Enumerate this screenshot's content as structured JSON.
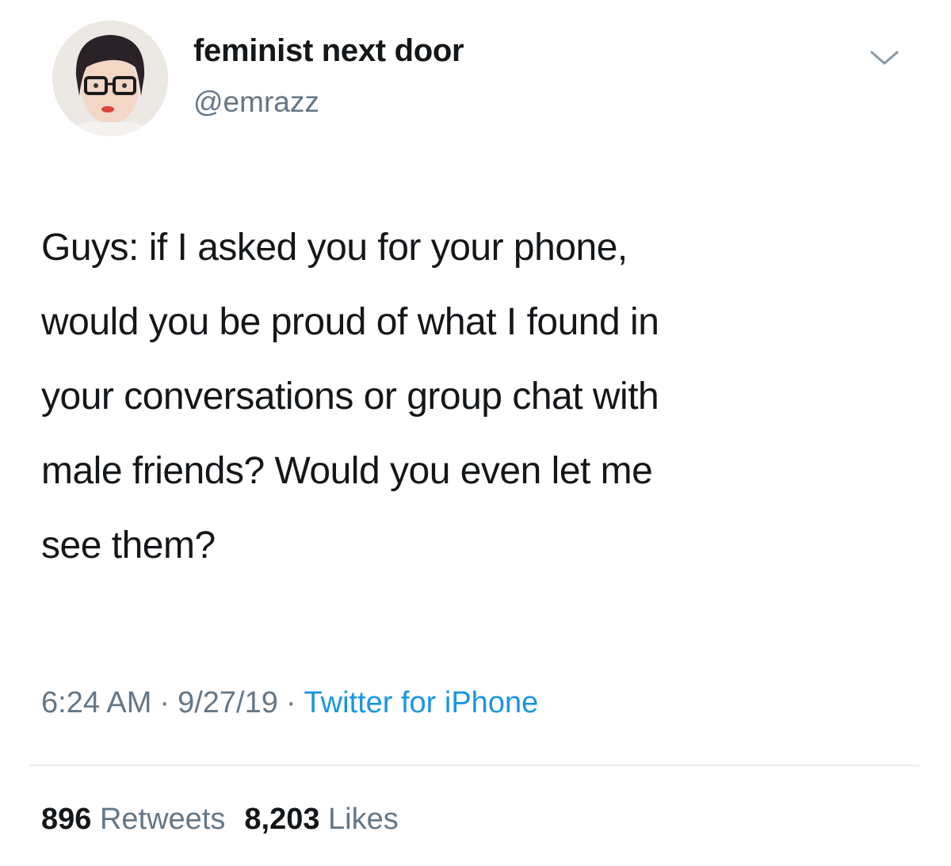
{
  "user": {
    "display_name": "feminist next door",
    "handle": "@emrazz"
  },
  "tweet": {
    "lines": [
      "Guys: if I asked you for your phone,",
      "would you be proud of what I found in",
      "your conversations or group chat with",
      "male friends? Would you even let me",
      "see them?"
    ]
  },
  "meta": {
    "time": "6:24 AM",
    "separator": "·",
    "date": "9/27/19",
    "source": "Twitter for iPhone"
  },
  "stats": {
    "retweets_count": "896",
    "retweets_label": "Retweets",
    "likes_count": "8,203",
    "likes_label": "Likes"
  },
  "colors": {
    "text": "#14171a",
    "secondary": "#657786",
    "link": "#1b95e0",
    "divider": "#e6ecf0"
  },
  "icons": {
    "caret": "chevron-down-icon"
  }
}
